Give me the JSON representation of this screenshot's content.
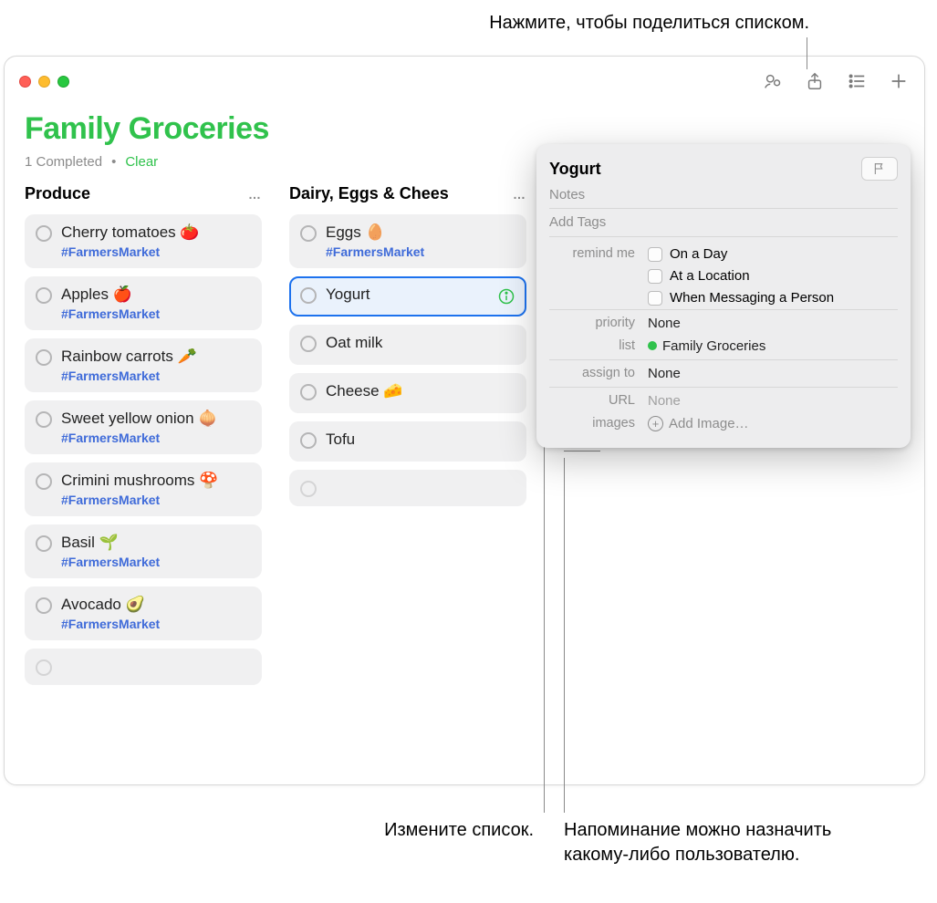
{
  "callouts": {
    "top": "Нажмите, чтобы поделиться списком.",
    "bottomLeft": "Измените список.",
    "bottomRight": "Напоминание можно назначить какому-либо пользователю."
  },
  "header": {
    "title": "Family Groceries",
    "completed_text": "1 Completed",
    "clear_label": "Clear"
  },
  "columns": [
    {
      "title": "Produce",
      "items": [
        {
          "title": "Cherry tomatoes 🍅",
          "tag": "#FarmersMarket"
        },
        {
          "title": "Apples 🍎",
          "tag": "#FarmersMarket"
        },
        {
          "title": "Rainbow carrots 🥕",
          "tag": "#FarmersMarket"
        },
        {
          "title": "Sweet yellow onion 🧅",
          "tag": "#FarmersMarket"
        },
        {
          "title": "Crimini mushrooms 🍄",
          "tag": "#FarmersMarket"
        },
        {
          "title": "Basil 🌱",
          "tag": "#FarmersMarket"
        },
        {
          "title": "Avocado 🥑",
          "tag": "#FarmersMarket"
        }
      ]
    },
    {
      "title": "Dairy, Eggs & Chees",
      "items": [
        {
          "title": "Eggs 🥚",
          "tag": "#FarmersMarket"
        },
        {
          "title": "Yogurt",
          "selected": true
        },
        {
          "title": "Oat milk"
        },
        {
          "title": "Cheese 🧀"
        },
        {
          "title": "Tofu"
        }
      ]
    }
  ],
  "inspector": {
    "title": "Yogurt",
    "notes_placeholder": "Notes",
    "tags_placeholder": "Add Tags",
    "labels": {
      "remind": "remind me",
      "priority": "priority",
      "list": "list",
      "assign": "assign to",
      "url": "URL",
      "images": "images"
    },
    "remind_options": {
      "day": "On a Day",
      "location": "At a Location",
      "messaging": "When Messaging a Person"
    },
    "priority_value": "None",
    "list_value": "Family Groceries",
    "assign_value": "None",
    "url_value": "None",
    "add_image_label": "Add Image…"
  },
  "more_glyph": "…"
}
